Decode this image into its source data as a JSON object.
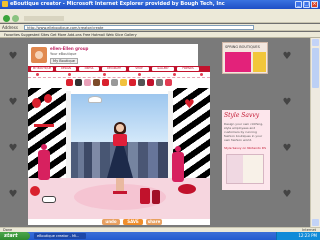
{
  "window": {
    "title": "eBoutique creator - Microsoft Internet Explorer provided by Bough Tech, Inc"
  },
  "address": {
    "label": "Address",
    "url": "http://www.elleboutique.com/creator/create"
  },
  "favorites": {
    "items": "Favorites   Suggested Sites   Get More Add-ons   Free Hotmail   Web Slice Gallery"
  },
  "user": {
    "name": "ellen-Ellen group",
    "subtitle": "Your eBoutique",
    "cta": "My Boutique"
  },
  "ad": {
    "title": "SPRING BOUTIQUES"
  },
  "app": {
    "tabs": [
      "MY BOUTIQUE",
      "DESIGN",
      "DRESS",
      "DECORATE",
      "SHOP",
      "GALLERY",
      "FRIENDS"
    ],
    "buttons": {
      "undo": "undo",
      "save": "SAVE",
      "share": "share"
    }
  },
  "side": {
    "title": "Style Savvy",
    "body": "Design your own clothing, style employees and customers by running fashion boutiques in your own fashion world.",
    "link": "Style Savvy on Nintendo DS"
  },
  "status": {
    "text": "Done",
    "zone": "Internet"
  },
  "taskbar": {
    "start": "start",
    "task": "eBoutique creator - Mi...",
    "clock": "12:23 PM"
  }
}
